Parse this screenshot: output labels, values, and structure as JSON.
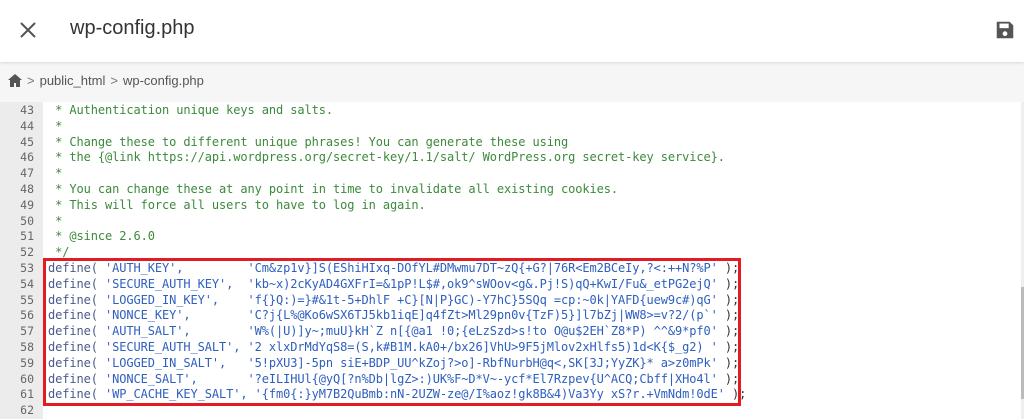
{
  "header": {
    "title": "wp-config.php",
    "close_icon": "close-icon",
    "save_icon": "save-icon"
  },
  "breadcrumb": {
    "home_icon": "home-icon",
    "items": [
      "public_html",
      "wp-config.php"
    ],
    "separator": ">"
  },
  "editor": {
    "comments": [
      {
        "n": "43",
        "text": " * Authentication unique keys and salts."
      },
      {
        "n": "44",
        "text": " *"
      },
      {
        "n": "45",
        "text": " * Change these to different unique phrases! You can generate these using"
      },
      {
        "n": "46",
        "text": " * the {@link https://api.wordpress.org/secret-key/1.1/salt/ WordPress.org secret-key service}."
      },
      {
        "n": "47",
        "text": " *"
      },
      {
        "n": "48",
        "text": " * You can change these at any point in time to invalidate all existing cookies."
      },
      {
        "n": "49",
        "text": " * This will force all users to have to log in again."
      },
      {
        "n": "50",
        "text": " *"
      },
      {
        "n": "51",
        "text": " * @since 2.6.0"
      },
      {
        "n": "52",
        "text": " */"
      }
    ],
    "defines": [
      {
        "n": "53",
        "fn": "define( ",
        "key": "'AUTH_KEY',",
        "pad": "         ",
        "val": "'Cm&zp1v}]S(EShiHIxq-DOfYL#DMwmu7DT~zQ{+G?|76R<Em2BCeIy,?<:++N?%P'",
        "end": " );"
      },
      {
        "n": "54",
        "fn": "define( ",
        "key": "'SECURE_AUTH_KEY',",
        "pad": "  ",
        "val": "'kb~x)2cKyAD4GXFrI=&1pP!L$#,ok9^sWOov<g&.Pj!S)qQ+KwI/Fu&_etPG2ejQ'",
        "end": " );"
      },
      {
        "n": "55",
        "fn": "define( ",
        "key": "'LOGGED_IN_KEY',",
        "pad": "    ",
        "val": "'f{}Q:)=}#&1t-5+DhlF +C}[N|P}GC)-Y7hC}5SQq =cp:~0k|YAFD{uew9c#)qG'",
        "end": " );"
      },
      {
        "n": "56",
        "fn": "define( ",
        "key": "'NONCE_KEY',",
        "pad": "        ",
        "val": "'C?j{L%@Ko6wSX6TJ5kb1iqE]q4fZt>Ml29pn0v{TzF)5}]l7bZj|WW8>=v?2/(p`'",
        "end": " );"
      },
      {
        "n": "57",
        "fn": "define( ",
        "key": "'AUTH_SALT',",
        "pad": "        ",
        "val": "'W%(|U)]y~;muU}kH`Z n[{@a1 !0;{eLzSzd>s!to O@u$2EH`Z8*P) ^^&9*pf0'",
        "end": " );"
      },
      {
        "n": "58",
        "fn": "define( ",
        "key": "'SECURE_AUTH_SALT',",
        "pad": " ",
        "val": "'2 xlxDrMdYqS8=(S,k#B1M.kA0+/bx26]VhU>9F5jMlov2xHlfs5)1d<K{$_g2) '",
        "end": " );"
      },
      {
        "n": "59",
        "fn": "define( ",
        "key": "'LOGGED_IN_SALT',",
        "pad": "   ",
        "val": "'5!pXU3]-5pn siE+BDP_UU^kZoj?>o]-RbfNurbH@q<,SK[3J;YyZK}* a>z0mPk'",
        "end": " );"
      },
      {
        "n": "60",
        "fn": "define( ",
        "key": "'NONCE_SALT',",
        "pad": "       ",
        "val": "'?eILIHUl{@yQ[?n%Db|lgZ>:)UK%F~D*V~-ycf*El7Rzpev{U^ACQ;Cbff|XHo4l'",
        "end": " );"
      },
      {
        "n": "61",
        "fn": "define( ",
        "key": "'WP_CACHE_KEY_SALT',",
        "pad": " ",
        "val": "'{fm0{:}yM7B2QuBmb:nN-2UZW-ze@/I%aoz!gk8B&4)Va3Yy xS?r.+VmNdm!0dE'",
        "end": " );"
      }
    ],
    "empty_line": {
      "n": "62"
    },
    "highlight_color": "#e31b23"
  }
}
